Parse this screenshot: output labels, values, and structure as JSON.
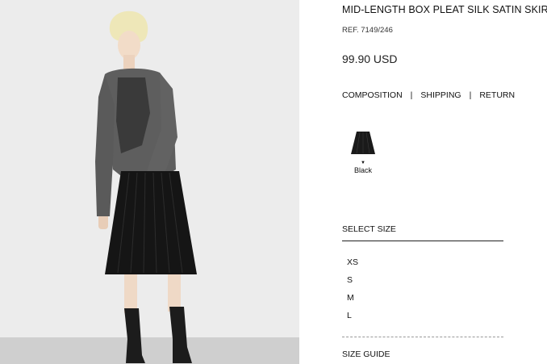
{
  "product": {
    "title": "MID-LENGTH BOX PLEAT SILK SATIN SKIRT",
    "ref": "REF. 7149/246",
    "price": "99.90 USD"
  },
  "links": {
    "composition": "COMPOSITION",
    "shipping": "SHIPPING",
    "return": "RETURN",
    "separator": "|"
  },
  "colors": {
    "selected_label": "Black",
    "swatch_color": "#1a1a1a"
  },
  "size_selector": {
    "heading": "SELECT SIZE",
    "options": [
      "XS",
      "S",
      "M",
      "L"
    ],
    "guide": "SIZE GUIDE"
  }
}
